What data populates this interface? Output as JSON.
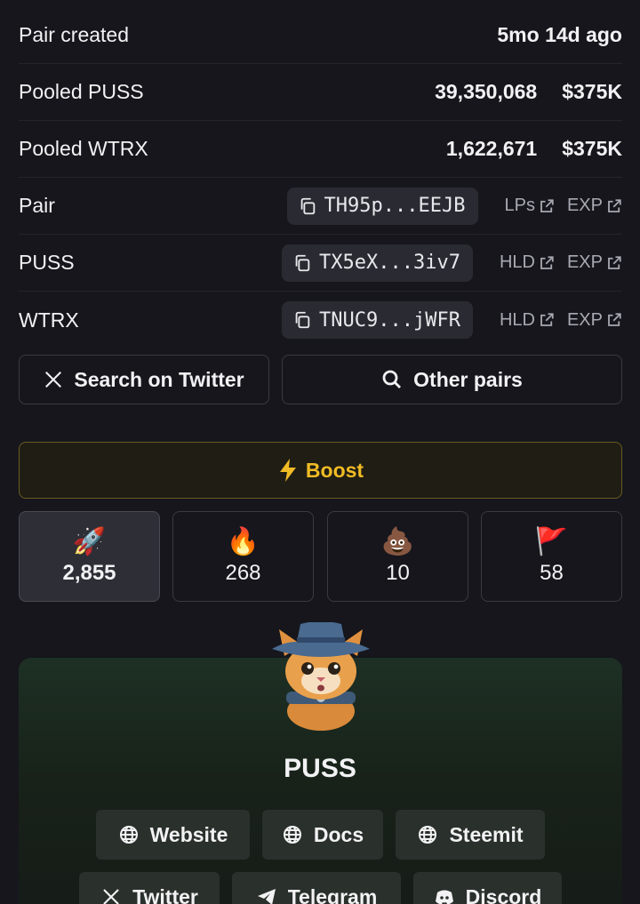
{
  "info_rows": [
    {
      "label": "Pair created",
      "value": "5mo 14d ago"
    },
    {
      "label": "Pooled PUSS",
      "amount": "39,350,068",
      "usd": "$375K"
    },
    {
      "label": "Pooled WTRX",
      "amount": "1,622,671",
      "usd": "$375K"
    }
  ],
  "address_rows": [
    {
      "label": "Pair",
      "address": "TH95p...EEJB",
      "link1": "LPs",
      "link2": "EXP"
    },
    {
      "label": "PUSS",
      "address": "TX5eX...3iv7",
      "link1": "HLD",
      "link2": "EXP"
    },
    {
      "label": "WTRX",
      "address": "TNUC9...jWFR",
      "link1": "HLD",
      "link2": "EXP"
    }
  ],
  "actions": {
    "twitter_search": "Search on Twitter",
    "other_pairs": "Other pairs",
    "boost": "Boost"
  },
  "reactions": [
    {
      "emoji": "🚀",
      "icon": "rocket-icon",
      "count": "2,855"
    },
    {
      "emoji": "🔥",
      "icon": "fire-icon",
      "count": "268"
    },
    {
      "emoji": "💩",
      "icon": "poop-icon",
      "count": "10"
    },
    {
      "emoji": "🚩",
      "icon": "red-flag-icon",
      "count": "58"
    }
  ],
  "token": {
    "name": "PUSS",
    "links": [
      "Website",
      "Docs",
      "Steemit",
      "Twitter",
      "Telegram",
      "Discord"
    ]
  },
  "colors": {
    "background": "#16161c",
    "boost_accent": "#f0bb24",
    "card_gradient_top": "#1e3025"
  }
}
